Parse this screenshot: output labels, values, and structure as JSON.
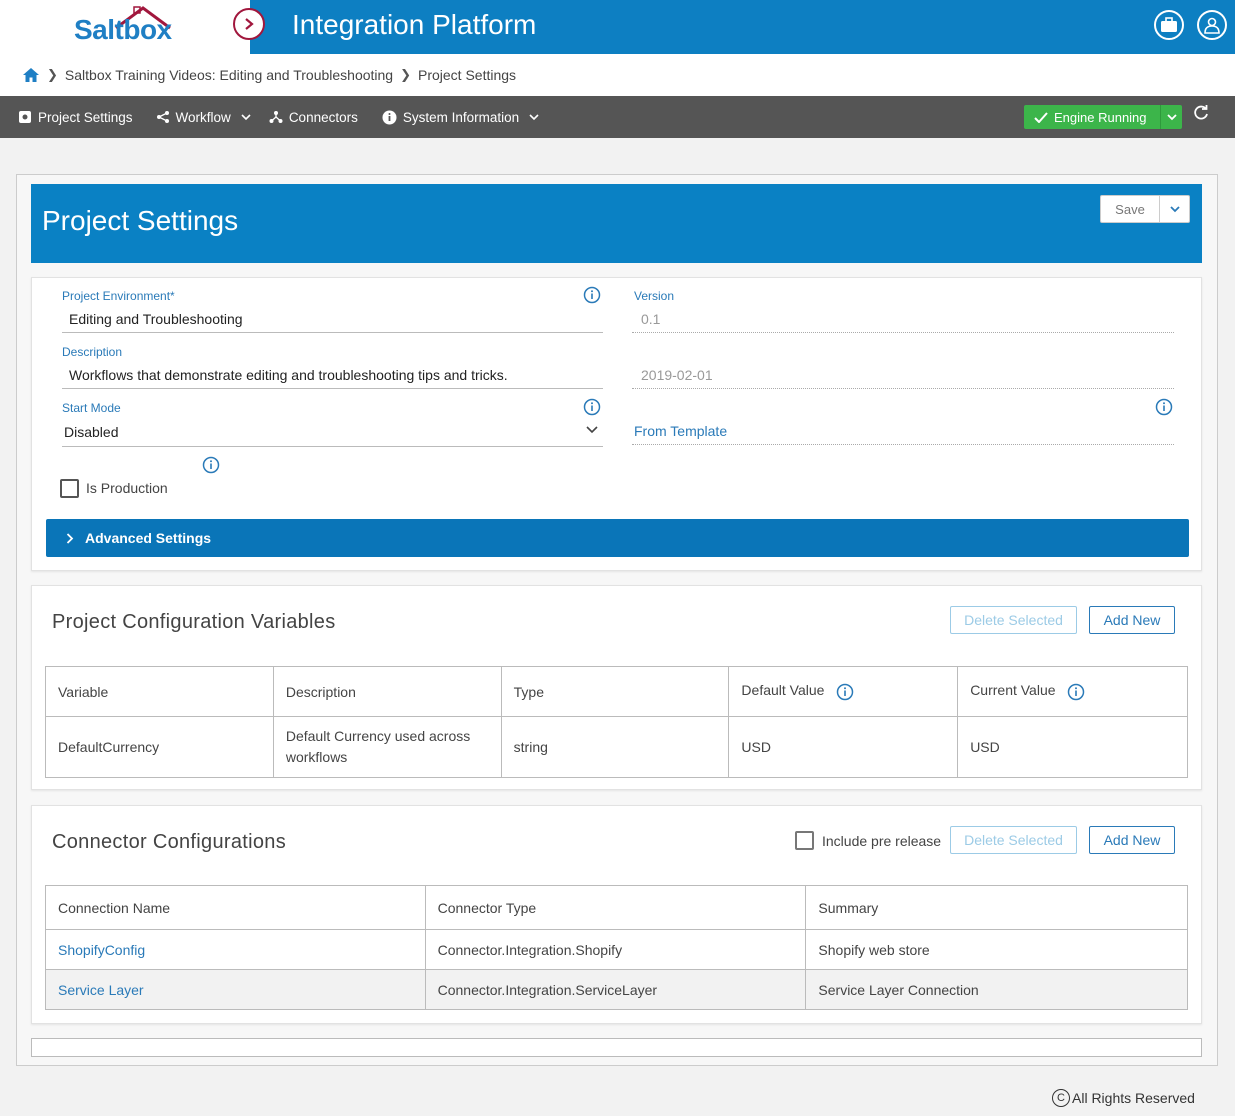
{
  "header": {
    "logo_text": "Saltbox",
    "app_title": "Integration Platform",
    "colors": {
      "primary": "#0d7fc2",
      "logo_red": "#a1173d",
      "engine_green": "#3cb54a"
    }
  },
  "breadcrumb": {
    "items": [
      "Saltbox Training Videos: Editing and Troubleshooting",
      "Project Settings"
    ]
  },
  "nav": {
    "items": [
      {
        "label": "Project Settings",
        "icon": "gear-icon"
      },
      {
        "label": "Workflow",
        "icon": "share-icon"
      },
      {
        "label": "Connectors",
        "icon": "connectors-icon"
      },
      {
        "label": "System Information",
        "icon": "info-icon"
      }
    ],
    "engine_status": "Engine Running"
  },
  "project_settings": {
    "title": "Project Settings",
    "save_label": "Save",
    "environment_label": "Project Environment*",
    "environment_value": "Editing and Troubleshooting",
    "version_label": "Version",
    "version_value": "0.1",
    "description_label": "Description",
    "description_value": "Workflows that demonstrate editing and troubleshooting tips and tricks.",
    "date_value": "2019-02-01",
    "start_mode_label": "Start Mode",
    "start_mode_value": "Disabled",
    "template_link": "From Template",
    "is_production_label": "Is Production",
    "advanced_label": "Advanced Settings"
  },
  "config_vars": {
    "title": "Project Configuration Variables",
    "delete_label": "Delete Selected",
    "add_label": "Add New",
    "columns": [
      "Variable",
      "Description",
      "Type",
      "Default Value",
      "Current Value"
    ],
    "rows": [
      {
        "variable": "DefaultCurrency",
        "description": "Default Currency used across workflows",
        "type": "string",
        "default": "USD",
        "current": "USD"
      }
    ]
  },
  "connectors": {
    "title": "Connector Configurations",
    "prerelease_label": "Include pre release",
    "delete_label": "Delete Selected",
    "add_label": "Add New",
    "columns": [
      "Connection Name",
      "Connector Type",
      "Summary"
    ],
    "rows": [
      {
        "name": "ShopifyConfig",
        "type": "Connector.Integration.Shopify",
        "summary": "Shopify web store"
      },
      {
        "name": "Service Layer",
        "type": "Connector.Integration.ServiceLayer",
        "summary": "Service Layer Connection"
      }
    ]
  },
  "footer": {
    "copyright": "All Rights Reserved",
    "copy_symbol": "C"
  }
}
